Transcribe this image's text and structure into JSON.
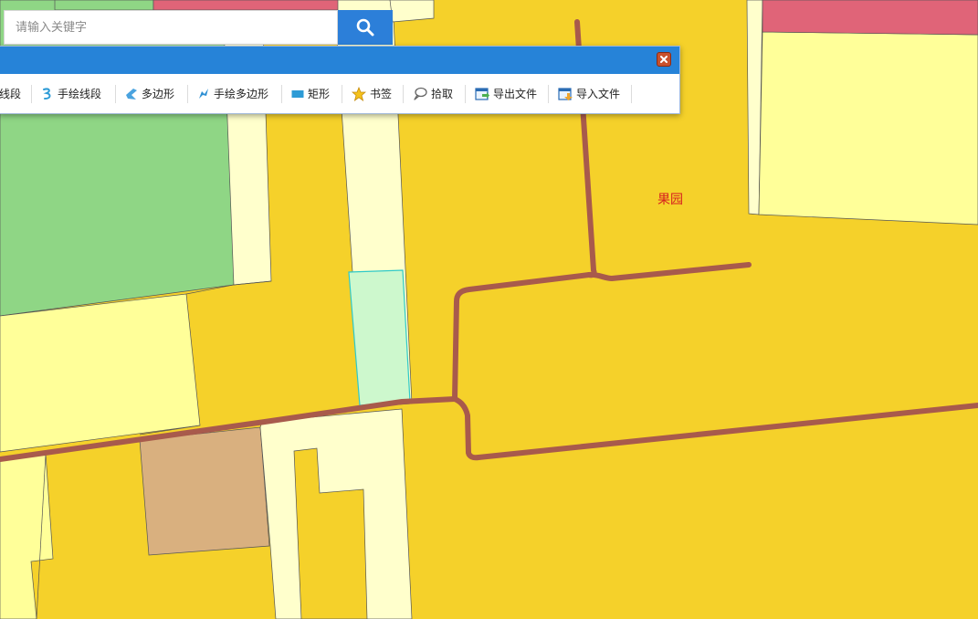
{
  "search": {
    "placeholder": "请输入关键字",
    "value": ""
  },
  "toolbar": {
    "items": [
      {
        "label": "线段",
        "icon": "polyline-icon"
      },
      {
        "label": "手绘线段",
        "icon": "freehand-line-icon"
      },
      {
        "label": "多边形",
        "icon": "polygon-icon"
      },
      {
        "label": "手绘多边形",
        "icon": "freehand-polygon-icon"
      },
      {
        "label": "矩形",
        "icon": "rectangle-icon"
      },
      {
        "label": "书签",
        "icon": "star-bookmark-icon"
      },
      {
        "label": "拾取",
        "icon": "pick-icon"
      },
      {
        "label": "导出文件",
        "icon": "export-file-icon"
      },
      {
        "label": "导入文件",
        "icon": "import-file-icon"
      }
    ]
  },
  "map": {
    "label_orchard": "果园"
  },
  "colors": {
    "farmland": "#f5d12a",
    "light_yellow": "#ffff99",
    "road_cream": "#ffffcc",
    "green": "#8fd685",
    "tan": "#d9b07f",
    "pink": "#e06478",
    "selection": "#cdf8cd",
    "road_line": "#a85a4c",
    "accent_blue": "#2683d8"
  }
}
